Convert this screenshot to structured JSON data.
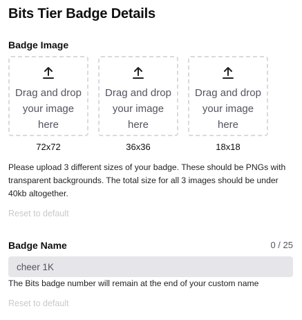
{
  "title": "Bits Tier Badge Details",
  "badge_image": {
    "label": "Badge Image",
    "dropzones": [
      {
        "text": "Drag and drop your image here",
        "size": "72x72",
        "icon": "upload-icon"
      },
      {
        "text": "Drag and drop your image here",
        "size": "36x36",
        "icon": "upload-icon"
      },
      {
        "text": "Drag and drop your image here",
        "size": "18x18",
        "icon": "upload-icon"
      }
    ],
    "help": "Please upload 3 different sizes of your badge. These should be PNGs with transparent backgrounds. The total size for all 3 images should be under 40kb altogether.",
    "reset_label": "Reset to default"
  },
  "badge_name": {
    "label": "Badge Name",
    "count": "0 / 25",
    "value": "cheer 1K",
    "help": "The Bits badge number will remain at the end of your custom name",
    "reset_label": "Reset to default"
  },
  "colors": {
    "dashed_border": "#dadadd",
    "input_bg": "#e6e6ea",
    "muted_link": "#c9c9cd"
  }
}
